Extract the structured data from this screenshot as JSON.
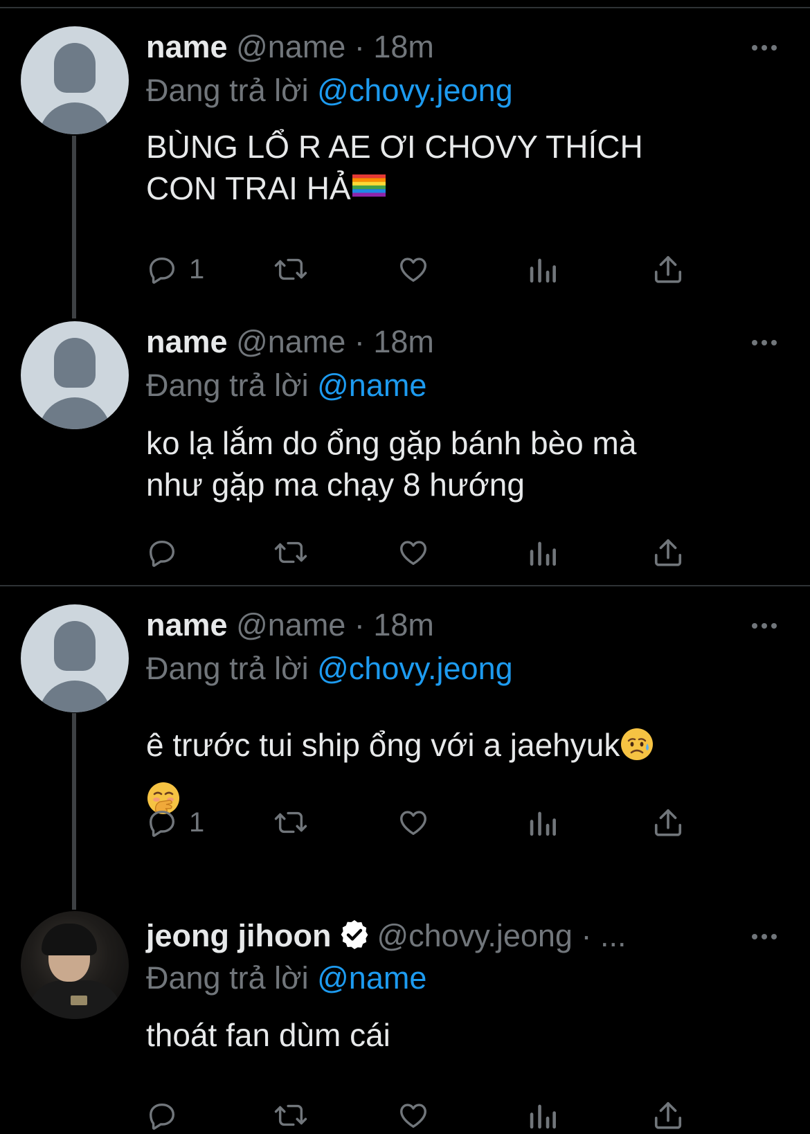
{
  "tweets": [
    {
      "name": "name",
      "handle": "@name",
      "time": "· 18m",
      "replying_label": "Đang trả lời",
      "replying_to": "@chovy.jeong",
      "text_lines": [
        "BÙNG LỔ R AE ƠI CHOVY THÍCH",
        "CON TRAI HẢ"
      ],
      "emoji": [
        "rainbow-flag"
      ],
      "reply_count": "1",
      "avatar": "default-avatar"
    },
    {
      "name": "name",
      "handle": "@name",
      "time": "· 18m",
      "replying_label": "Đang trả lời",
      "replying_to": "@name",
      "text_lines": [
        "ko lạ lắm do ổng gặp bánh bèo mà",
        "như gặp ma chạy 8 hướng"
      ],
      "reply_count": "",
      "avatar": "default-avatar"
    },
    {
      "name": "name",
      "handle": "@name",
      "time": "· 18m",
      "replying_label": "Đang trả lời",
      "replying_to": "@chovy.jeong",
      "text_lines": [
        "ê trước tui ship ổng với a jaehyuk",
        ""
      ],
      "emoji": [
        "sad-but-relieved-face",
        "face-with-hand-over-mouth"
      ],
      "reply_count": "1",
      "avatar": "default-avatar"
    },
    {
      "name": "jeong jihoon",
      "handle": "@chovy.jeong",
      "time": "· ...",
      "replying_label": "Đang trả lời",
      "replying_to": "@name",
      "text_lines": [
        "thoát fan dùm cái"
      ],
      "reply_count": "",
      "avatar": "profile-photo",
      "verified": true
    }
  ],
  "icons": {
    "reply": "reply-icon",
    "retweet": "retweet-icon",
    "like": "like-icon",
    "views": "views-icon",
    "share": "share-icon",
    "more": "more-icon",
    "verified": "verified-badge-icon"
  },
  "colors": {
    "background": "#000000",
    "text": "#e7e9ea",
    "muted": "#71767b",
    "link": "#1d9bf0",
    "divider": "#2f3336"
  }
}
